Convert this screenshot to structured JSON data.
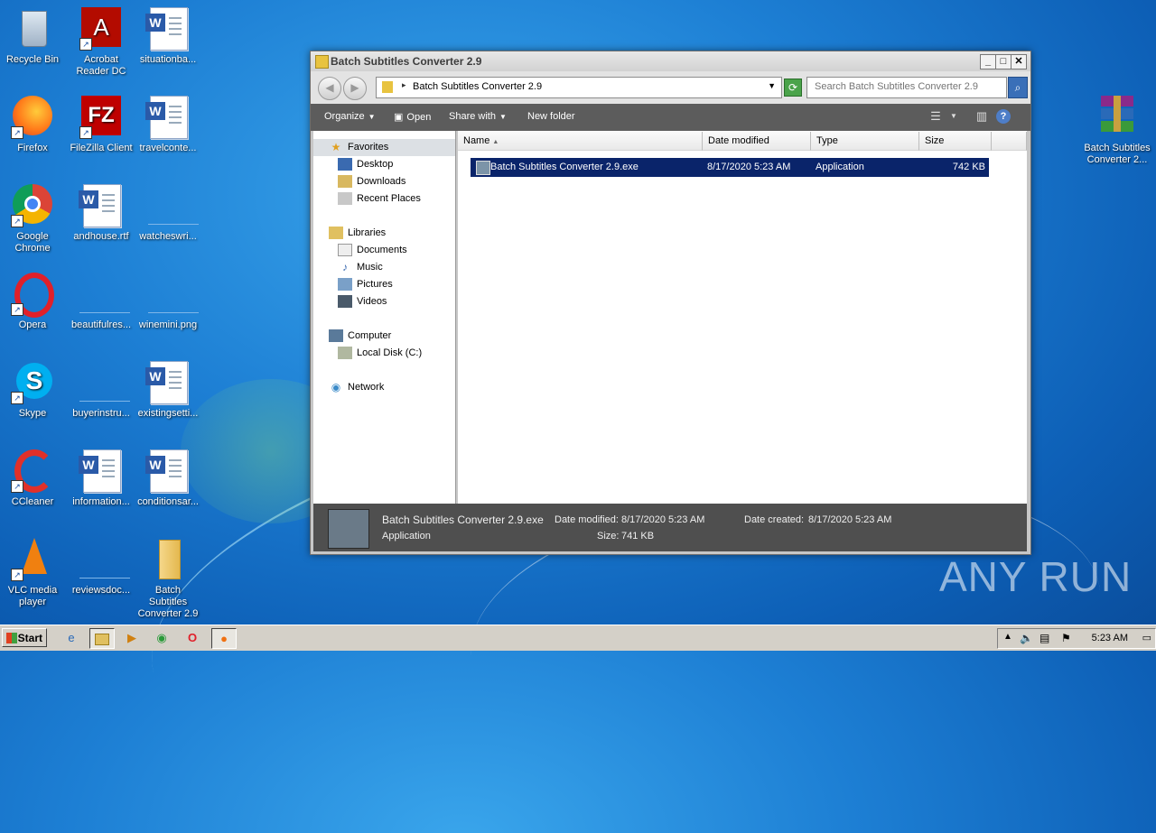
{
  "desktop": {
    "icons": [
      {
        "label": "Recycle Bin"
      },
      {
        "label": "Acrobat Reader DC"
      },
      {
        "label": "situationba..."
      },
      {
        "label": "Firefox"
      },
      {
        "label": "FileZilla Client"
      },
      {
        "label": "travelconte..."
      },
      {
        "label": "Google Chrome"
      },
      {
        "label": "andhouse.rtf"
      },
      {
        "label": "watcheswri..."
      },
      {
        "label": "Opera"
      },
      {
        "label": "beautifulres..."
      },
      {
        "label": "winemini.png"
      },
      {
        "label": "Skype"
      },
      {
        "label": "buyerinstru..."
      },
      {
        "label": "existingsetti..."
      },
      {
        "label": "CCleaner"
      },
      {
        "label": "information..."
      },
      {
        "label": "conditionsar..."
      },
      {
        "label": "VLC media player"
      },
      {
        "label": "reviewsdoc..."
      },
      {
        "label": "Batch Subtitles Converter 2.9"
      },
      {
        "label": "Batch Subtitles Converter 2..."
      }
    ]
  },
  "window": {
    "title": "Batch Subtitles Converter 2.9",
    "address": "Batch Subtitles Converter 2.9",
    "search_placeholder": "Search Batch Subtitles Converter 2.9",
    "toolbar": {
      "organize": "Organize",
      "open": "Open",
      "share_with": "Share with",
      "new_folder": "New folder"
    },
    "nav": {
      "favorites": "Favorites",
      "desktop": "Desktop",
      "downloads": "Downloads",
      "recent_places": "Recent Places",
      "libraries": "Libraries",
      "documents": "Documents",
      "music": "Music",
      "pictures": "Pictures",
      "videos": "Videos",
      "computer": "Computer",
      "local_disk": "Local Disk (C:)",
      "network": "Network"
    },
    "columns": {
      "name": "Name",
      "date_modified": "Date modified",
      "type": "Type",
      "size": "Size"
    },
    "files": [
      {
        "name": "Batch Subtitles Converter 2.9.exe",
        "date_modified": "8/17/2020 5:23 AM",
        "type": "Application",
        "size": "742 KB"
      }
    ],
    "details": {
      "name": "Batch Subtitles Converter 2.9.exe",
      "type": "Application",
      "date_modified_label": "Date modified:",
      "date_modified": "8/17/2020 5:23 AM",
      "date_created_label": "Date created:",
      "date_created": "8/17/2020 5:23 AM",
      "size_label": "Size:",
      "size": "741 KB"
    }
  },
  "taskbar": {
    "start": "Start",
    "clock": "5:23 AM"
  },
  "watermark": "ANY RUN"
}
